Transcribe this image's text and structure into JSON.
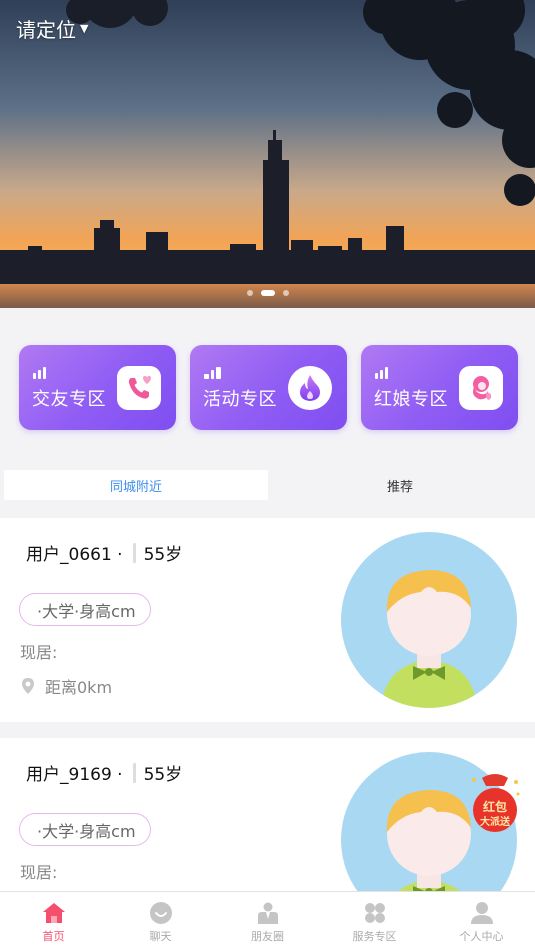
{
  "banner": {
    "location_label": "请定位",
    "slide_count": 3,
    "active_slide": 2
  },
  "feature_cards": [
    {
      "title": "交友专区",
      "icon": "phone-heart-icon"
    },
    {
      "title": "活动专区",
      "icon": "flame-icon"
    },
    {
      "title": "红娘专区",
      "icon": "matchmaker-icon"
    }
  ],
  "tabs": [
    {
      "label": "同城附近",
      "active": true
    },
    {
      "label": "推荐",
      "active": false
    }
  ],
  "users": [
    {
      "name": "用户_0661 ·",
      "age": "55岁",
      "tags": "·大学·身高cm",
      "residence": "现居:",
      "distance": "距离0km"
    },
    {
      "name": "用户_9169 ·",
      "age": "55岁",
      "tags": "·大学·身高cm",
      "residence": "现居:"
    }
  ],
  "red_packet": {
    "line1": "红包",
    "line2": "大派送"
  },
  "bottom_nav": [
    {
      "label": "首页",
      "icon": "home-icon",
      "active": true
    },
    {
      "label": "聊天",
      "icon": "chat-icon",
      "active": false
    },
    {
      "label": "朋友圈",
      "icon": "moments-icon",
      "active": false
    },
    {
      "label": "服务专区",
      "icon": "services-icon",
      "active": false
    },
    {
      "label": "个人中心",
      "icon": "profile-icon",
      "active": false
    }
  ],
  "colors": {
    "accent": "#f4506d",
    "tab_active": "#3d8ef0",
    "card_purple": "#8f5cf4",
    "tag_border": "#e7b6ef"
  }
}
